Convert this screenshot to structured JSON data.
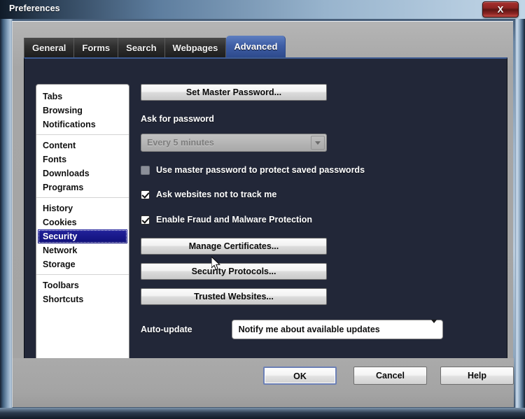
{
  "window": {
    "title": "Preferences",
    "close_label": "X"
  },
  "tabs": [
    {
      "label": "General",
      "active": false
    },
    {
      "label": "Forms",
      "active": false
    },
    {
      "label": "Search",
      "active": false
    },
    {
      "label": "Webpages",
      "active": false
    },
    {
      "label": "Advanced",
      "active": true
    }
  ],
  "sidebar": {
    "selected": "Security",
    "groups": [
      {
        "items": [
          "Tabs",
          "Browsing",
          "Notifications"
        ]
      },
      {
        "items": [
          "Content",
          "Fonts",
          "Downloads",
          "Programs"
        ]
      },
      {
        "items": [
          "History",
          "Cookies",
          "Security",
          "Network",
          "Storage"
        ]
      },
      {
        "items": [
          "Toolbars",
          "Shortcuts"
        ]
      }
    ]
  },
  "panel": {
    "set_master_password_button": "Set Master Password...",
    "ask_for_password_label": "Ask for password",
    "ask_for_password_value": "Every 5 minutes",
    "ask_for_password_disabled": true,
    "checkboxes": [
      {
        "label": "Use master password to protect saved passwords",
        "checked": false,
        "disabled": true
      },
      {
        "label": "Ask websites not to track me",
        "checked": true,
        "disabled": false
      },
      {
        "label": "Enable Fraud and Malware Protection",
        "checked": true,
        "disabled": false
      }
    ],
    "manage_certificates_button": "Manage Certificates...",
    "security_protocols_button": "Security Protocols...",
    "trusted_websites_button": "Trusted Websites...",
    "auto_update_label": "Auto-update",
    "auto_update_value": "Notify me about available updates"
  },
  "footer": {
    "ok_label": "OK",
    "cancel_label": "Cancel",
    "help_label": "Help"
  },
  "colors": {
    "panel_background": "#222738",
    "tab_active": "#3f5ea6",
    "selection": "#1a1a8c",
    "close_button": "#8e2523",
    "dialog_grey": "#a9a9a9"
  }
}
